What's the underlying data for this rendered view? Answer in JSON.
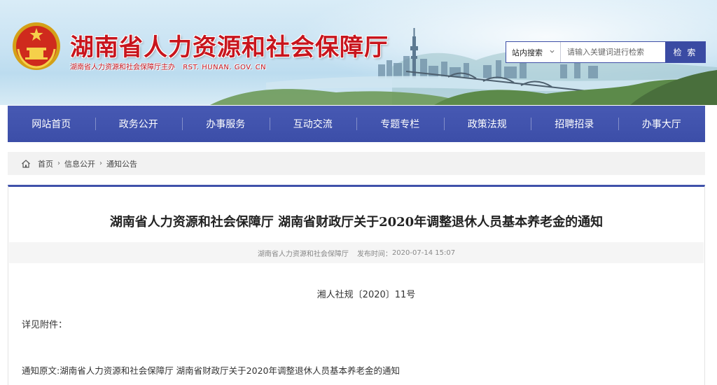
{
  "header": {
    "site_title": "湖南省人力资源和社会保障厅",
    "site_subtitle": "湖南省人力资源和社会保障厅主办",
    "site_domain": "RST. HUNAN. GOV. CN",
    "search": {
      "scope_selected": "站内搜索",
      "placeholder": "请输入关键词进行检索",
      "button_label": "检 索"
    }
  },
  "nav": {
    "items": [
      {
        "label": "网站首页"
      },
      {
        "label": "政务公开"
      },
      {
        "label": "办事服务"
      },
      {
        "label": "互动交流"
      },
      {
        "label": "专题专栏"
      },
      {
        "label": "政策法规"
      },
      {
        "label": "招聘招录"
      },
      {
        "label": "办事大厅"
      }
    ]
  },
  "breadcrumb": {
    "items": [
      "首页",
      "信息公开",
      "通知公告"
    ],
    "separator": "›"
  },
  "article": {
    "title": "湖南省人力资源和社会保障厅 湖南省财政厅关于2020年调整退休人员基本养老金的通知",
    "source": "湖南省人力资源和社会保障厅",
    "publish_label": "发布时间：",
    "publish_time": "2020-07-14 15:07",
    "doc_number": "湘人社规〔2020〕11号",
    "paragraph_1": "详见附件：",
    "paragraph_2": "通知原文:湖南省人力资源和社会保障厅 湖南省财政厅关于2020年调整退休人员基本养老金的通知"
  },
  "colors": {
    "brand_red": "#c8151d",
    "nav_blue": "#3f51aa",
    "search_button": "#3a4ba3",
    "breadcrumb_bg": "#f2f2f2"
  },
  "icons": [
    "national-emblem-icon",
    "chevron-down-icon",
    "home-icon",
    "chevron-right-icon"
  ]
}
